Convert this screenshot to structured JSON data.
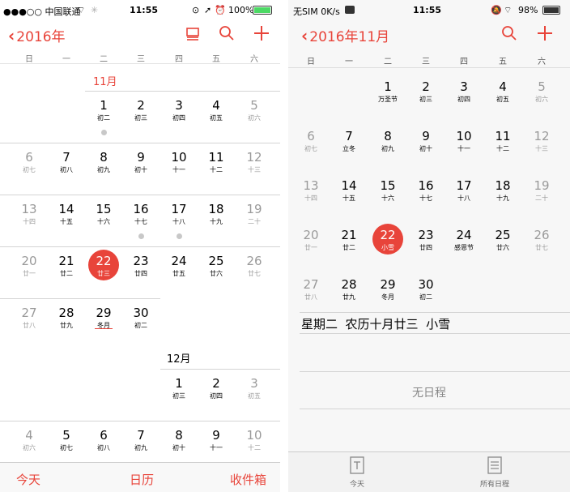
{
  "left": {
    "status": {
      "carrier": "●●●○○ 中国联通",
      "time": "11:55",
      "battery": "100%"
    },
    "nav": {
      "back_label": "2016年"
    },
    "weekdays": [
      "日",
      "一",
      "二",
      "三",
      "四",
      "五",
      "六"
    ],
    "nov_label": "11月",
    "dec_label": "12月",
    "nov": [
      {
        "d": "1",
        "l": "初二"
      },
      {
        "d": "2",
        "l": "初三"
      },
      {
        "d": "3",
        "l": "初四"
      },
      {
        "d": "4",
        "l": "初五"
      },
      {
        "d": "5",
        "l": "初六"
      },
      {
        "d": "6",
        "l": "初七"
      },
      {
        "d": "7",
        "l": "初八"
      },
      {
        "d": "8",
        "l": "初九"
      },
      {
        "d": "9",
        "l": "初十"
      },
      {
        "d": "10",
        "l": "十一"
      },
      {
        "d": "11",
        "l": "十二"
      },
      {
        "d": "12",
        "l": "十三"
      },
      {
        "d": "13",
        "l": "十四"
      },
      {
        "d": "14",
        "l": "十五"
      },
      {
        "d": "15",
        "l": "十六"
      },
      {
        "d": "16",
        "l": "十七"
      },
      {
        "d": "17",
        "l": "十八"
      },
      {
        "d": "18",
        "l": "十九"
      },
      {
        "d": "19",
        "l": "二十"
      },
      {
        "d": "20",
        "l": "廿一"
      },
      {
        "d": "21",
        "l": "廿二"
      },
      {
        "d": "22",
        "l": "廿三"
      },
      {
        "d": "23",
        "l": "廿四"
      },
      {
        "d": "24",
        "l": "廿五"
      },
      {
        "d": "25",
        "l": "廿六"
      },
      {
        "d": "26",
        "l": "廿七"
      },
      {
        "d": "27",
        "l": "廿八"
      },
      {
        "d": "28",
        "l": "廿九"
      },
      {
        "d": "29",
        "l": "冬月"
      },
      {
        "d": "30",
        "l": "初二"
      }
    ],
    "dec": [
      {
        "d": "1",
        "l": "初三"
      },
      {
        "d": "2",
        "l": "初四"
      },
      {
        "d": "3",
        "l": "初五"
      },
      {
        "d": "4",
        "l": "初六"
      },
      {
        "d": "5",
        "l": "初七"
      },
      {
        "d": "6",
        "l": "初八"
      },
      {
        "d": "7",
        "l": "初九"
      },
      {
        "d": "8",
        "l": "初十"
      },
      {
        "d": "9",
        "l": "十一"
      },
      {
        "d": "10",
        "l": "十二"
      }
    ],
    "tabs": {
      "today": "今天",
      "calendars": "日历",
      "inbox": "收件箱"
    }
  },
  "right": {
    "status": {
      "carrier": "无SIM 0K/s",
      "time": "11:55",
      "battery": "98%"
    },
    "nav": {
      "back_label": "2016年11月"
    },
    "weekdays": [
      "日",
      "一",
      "二",
      "三",
      "四",
      "五",
      "六"
    ],
    "days": [
      {
        "d": "1",
        "l": "万圣节"
      },
      {
        "d": "2",
        "l": "初三"
      },
      {
        "d": "3",
        "l": "初四"
      },
      {
        "d": "4",
        "l": "初五"
      },
      {
        "d": "5",
        "l": "初六"
      },
      {
        "d": "6",
        "l": "初七"
      },
      {
        "d": "7",
        "l": "立冬"
      },
      {
        "d": "8",
        "l": "初九"
      },
      {
        "d": "9",
        "l": "初十"
      },
      {
        "d": "10",
        "l": "十一"
      },
      {
        "d": "11",
        "l": "十二"
      },
      {
        "d": "12",
        "l": "十三"
      },
      {
        "d": "13",
        "l": "十四"
      },
      {
        "d": "14",
        "l": "十五"
      },
      {
        "d": "15",
        "l": "十六"
      },
      {
        "d": "16",
        "l": "十七"
      },
      {
        "d": "17",
        "l": "十八"
      },
      {
        "d": "18",
        "l": "十九"
      },
      {
        "d": "19",
        "l": "二十"
      },
      {
        "d": "20",
        "l": "廿一"
      },
      {
        "d": "21",
        "l": "廿二"
      },
      {
        "d": "22",
        "l": "小雪"
      },
      {
        "d": "23",
        "l": "廿四"
      },
      {
        "d": "24",
        "l": "感恩节"
      },
      {
        "d": "25",
        "l": "廿六"
      },
      {
        "d": "26",
        "l": "廿七"
      },
      {
        "d": "27",
        "l": "廿八"
      },
      {
        "d": "28",
        "l": "廿九"
      },
      {
        "d": "29",
        "l": "冬月"
      },
      {
        "d": "30",
        "l": "初二"
      }
    ],
    "selected_info": "星期二  农历十月廿三  小雪",
    "empty_text": "无日程",
    "tabs": {
      "today": "今天",
      "all_events": "所有日程"
    }
  },
  "colors": {
    "accent": "#e8443a",
    "gray_text": "#9a9a9a"
  }
}
